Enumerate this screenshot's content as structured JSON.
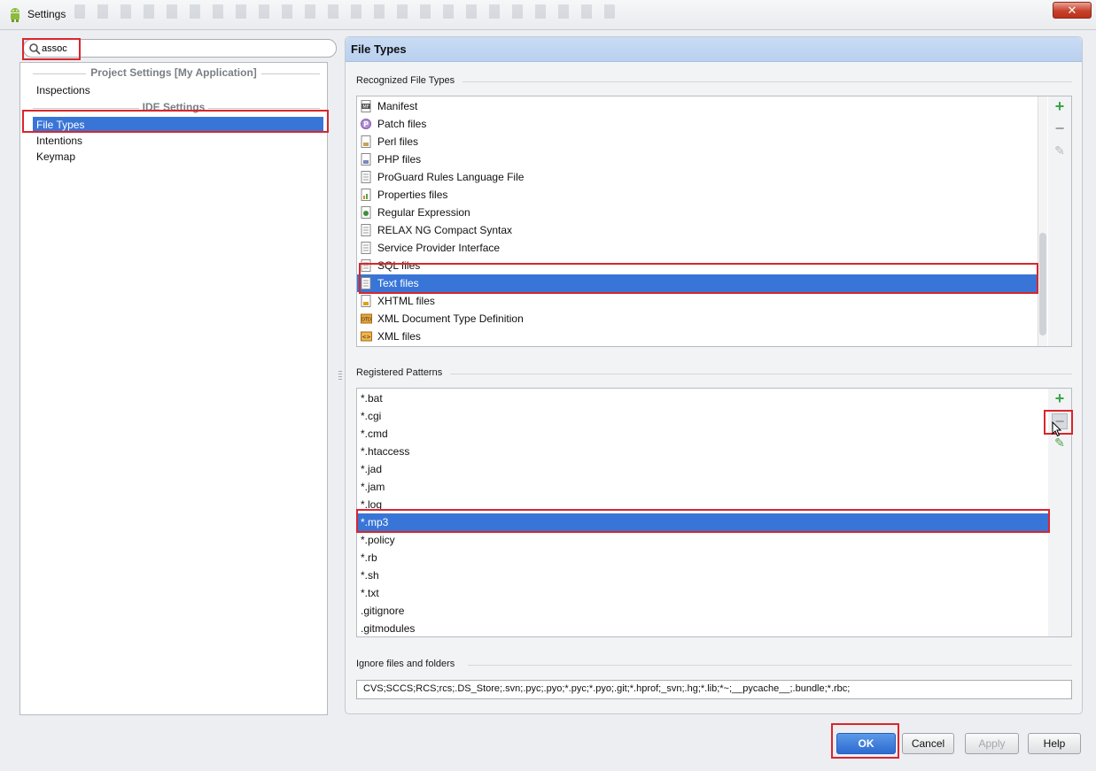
{
  "window": {
    "title": "Settings",
    "close_label": "✕"
  },
  "search": {
    "value": "assoc"
  },
  "left_nav": {
    "groups": [
      {
        "header": "Project Settings [My Application]",
        "items": [
          "Inspections"
        ]
      },
      {
        "header": "IDE Settings",
        "items": [
          "File Types",
          "Intentions",
          "Keymap"
        ]
      }
    ],
    "selected": "File Types"
  },
  "panel": {
    "title": "File Types",
    "recognized_label": "Recognized File Types",
    "recognized": [
      {
        "name": "Manifest",
        "icon": "manifest-icon"
      },
      {
        "name": "Patch files",
        "icon": "patch-icon"
      },
      {
        "name": "Perl files",
        "icon": "perl-file-icon"
      },
      {
        "name": "PHP files",
        "icon": "php-file-icon"
      },
      {
        "name": "ProGuard Rules Language File",
        "icon": "document-icon"
      },
      {
        "name": "Properties files",
        "icon": "properties-icon"
      },
      {
        "name": "Regular Expression",
        "icon": "regex-icon"
      },
      {
        "name": "RELAX NG Compact Syntax",
        "icon": "document-icon"
      },
      {
        "name": "Service Provider Interface",
        "icon": "document-icon"
      },
      {
        "name": "SQL files",
        "icon": "sql-file-icon"
      },
      {
        "name": "Text files",
        "icon": "text-file-icon"
      },
      {
        "name": "XHTML files",
        "icon": "xhtml-icon"
      },
      {
        "name": "XML Document Type Definition",
        "icon": "dtd-icon"
      },
      {
        "name": "XML files",
        "icon": "xml-file-icon"
      }
    ],
    "recognized_selected": "Text files",
    "patterns_label": "Registered Patterns",
    "patterns": [
      "*.bat",
      "*.cgi",
      "*.cmd",
      "*.htaccess",
      "*.jad",
      "*.jam",
      "*.log",
      "*.mp3",
      "*.policy",
      "*.rb",
      "*.sh",
      "*.txt",
      ".gitignore",
      ".gitmodules"
    ],
    "patterns_selected": "*.mp3",
    "ignore_label": "Ignore files and folders",
    "ignore_value": "CVS;SCCS;RCS;rcs;.DS_Store;.svn;.pyc;.pyo;*.pyc;*.pyo;.git;*.hprof;_svn;.hg;*.lib;*~;__pycache__;.bundle;*.rbc;"
  },
  "tools": {
    "add": "+",
    "remove": "−",
    "edit": "✎"
  },
  "buttons": {
    "ok": "OK",
    "cancel": "Cancel",
    "apply": "Apply",
    "help": "Help"
  },
  "colors": {
    "selection": "#3875d7",
    "header": "#c2d6f2",
    "highlight": "#d9262c"
  }
}
